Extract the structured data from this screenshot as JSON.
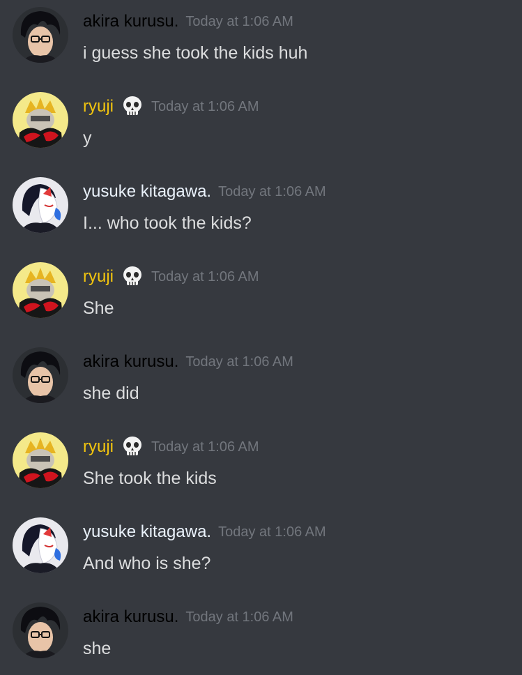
{
  "chat": {
    "messages": [
      {
        "author": "akira kurusu.",
        "author_key": "akira",
        "avatar": "akira-avatar",
        "badge": "",
        "timestamp": "Today at 1:06 AM",
        "content": "i guess she took the kids huh"
      },
      {
        "author": "ryuji",
        "author_key": "ryuji",
        "avatar": "ryuji-avatar",
        "badge": "skull-emoji",
        "timestamp": "Today at 1:06 AM",
        "content": "y"
      },
      {
        "author": "yusuke kitagawa.",
        "author_key": "yusuke",
        "avatar": "yusuke-avatar",
        "badge": "",
        "timestamp": "Today at 1:06 AM",
        "content": "I... who took the kids?"
      },
      {
        "author": "ryuji",
        "author_key": "ryuji",
        "avatar": "ryuji-avatar",
        "badge": "skull-emoji",
        "timestamp": "Today at 1:06 AM",
        "content": "She"
      },
      {
        "author": "akira kurusu.",
        "author_key": "akira",
        "avatar": "akira-avatar",
        "badge": "",
        "timestamp": "Today at 1:06 AM",
        "content": "she did"
      },
      {
        "author": "ryuji",
        "author_key": "ryuji",
        "avatar": "ryuji-avatar",
        "badge": "skull-emoji",
        "timestamp": "Today at 1:06 AM",
        "content": "She took the kids"
      },
      {
        "author": "yusuke kitagawa.",
        "author_key": "yusuke",
        "avatar": "yusuke-avatar",
        "badge": "",
        "timestamp": "Today at 1:06 AM",
        "content": "And who is she?"
      },
      {
        "author": "akira kurusu.",
        "author_key": "akira",
        "avatar": "akira-avatar",
        "badge": "",
        "timestamp": "Today at 1:06 AM",
        "content": "she"
      }
    ]
  },
  "colors": {
    "background": "#36393f",
    "message_text": "#dcddde",
    "timestamp": "#72767d",
    "akira_name": "#000000",
    "ryuji_name": "#f1c40f",
    "yusuke_name": "#eaf2fb"
  }
}
